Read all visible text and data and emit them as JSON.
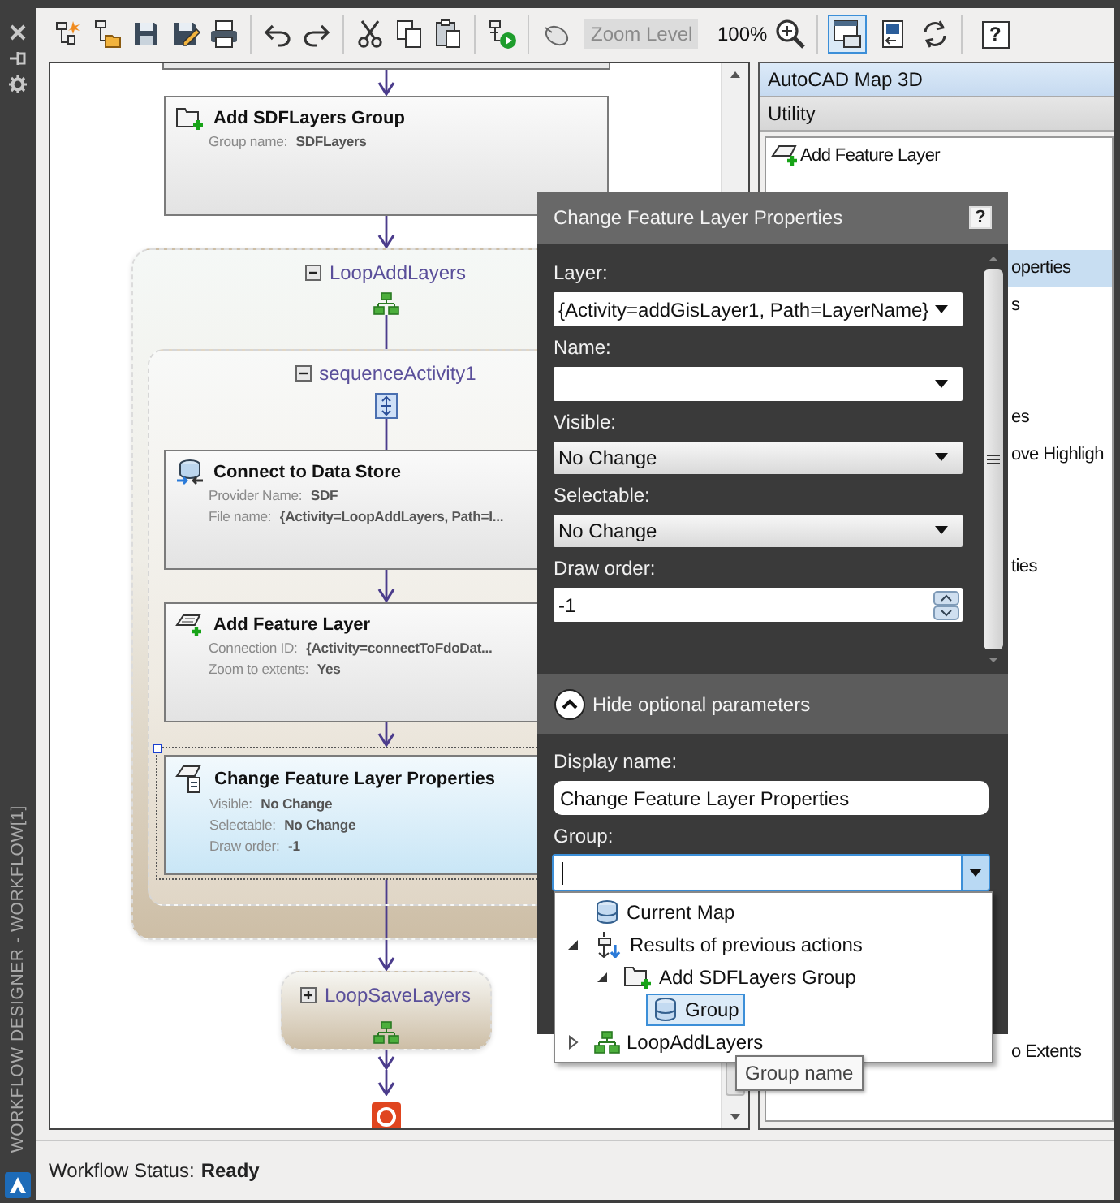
{
  "side_strip": {
    "title": "WORKFLOW DESIGNER - WORKFLOW[1]"
  },
  "toolbar": {
    "zoom_field": {
      "placeholder": "Zoom Level",
      "disabled": true
    },
    "zoom_value": "100%",
    "help_label": "?",
    "view_toggles": [
      {
        "selected": true
      },
      {
        "selected": false
      }
    ]
  },
  "workflow": {
    "items": [
      {
        "kind": "activity",
        "title": "Add SDFLayers Group",
        "selected": false,
        "fields": [
          {
            "label": "Group name:",
            "value": "SDFLayers"
          }
        ]
      },
      {
        "kind": "loop",
        "title": "LoopAddLayers",
        "expanded": true,
        "children": [
          {
            "kind": "sequence",
            "title": "sequenceActivity1",
            "expanded": true,
            "children": [
              {
                "kind": "activity",
                "title": "Connect to Data Store",
                "selected": false,
                "fields": [
                  {
                    "label": "Provider Name:",
                    "value": "SDF"
                  },
                  {
                    "label": "File name:",
                    "value": "{Activity=LoopAddLayers, Path=I..."
                  }
                ]
              },
              {
                "kind": "activity",
                "title": "Add Feature Layer",
                "selected": false,
                "fields": [
                  {
                    "label": "Connection ID:",
                    "value": "{Activity=connectToFdoDat..."
                  },
                  {
                    "label": "Zoom to extents:",
                    "value": "Yes"
                  }
                ]
              },
              {
                "kind": "activity",
                "title": "Change Feature Layer Properties",
                "selected": true,
                "fields": [
                  {
                    "label": "Visible:",
                    "value": "No Change"
                  },
                  {
                    "label": "Selectable:",
                    "value": "No Change"
                  },
                  {
                    "label": "Draw order:",
                    "value": "-1"
                  }
                ]
              }
            ]
          }
        ]
      },
      {
        "kind": "loop",
        "title": "LoopSaveLayers",
        "expanded": false
      }
    ]
  },
  "toolbox": {
    "sections": [
      {
        "title": "AutoCAD Map 3D",
        "selected": true
      },
      {
        "title": "Utility",
        "selected": false
      }
    ],
    "items": [
      {
        "text": "Add Feature Layer",
        "selected": false
      },
      {
        "text": "operties",
        "selected": true
      },
      {
        "text": "s",
        "selected": false
      },
      {
        "text": "es",
        "selected": false
      },
      {
        "text": "ove Highligh",
        "selected": false
      },
      {
        "text": "ties",
        "selected": false
      },
      {
        "text": "o Extents",
        "selected": false
      }
    ]
  },
  "properties_dialog": {
    "title": "Change Feature Layer Properties",
    "help_label": "?",
    "fields": [
      {
        "kind": "combo",
        "label": "Layer:",
        "value": "{Activity=addGisLayer1, Path=LayerName}"
      },
      {
        "kind": "combo",
        "label": "Name:"
      },
      {
        "kind": "dropdown",
        "label": "Visible:",
        "value": "No Change"
      },
      {
        "kind": "dropdown",
        "label": "Selectable:",
        "value": "No Change"
      },
      {
        "kind": "spin",
        "label": "Draw order:",
        "value": "-1"
      }
    ],
    "optional_toggle": {
      "label": "Hide optional parameters",
      "expanded": true
    },
    "optional_fields": [
      {
        "kind": "text",
        "label": "Display name:",
        "value": "Change Feature Layer Properties"
      },
      {
        "kind": "combo",
        "label": "Group:",
        "focused": true,
        "open": true
      }
    ],
    "group_dropdown": {
      "items": [
        {
          "kind": "map",
          "label": "Current Map",
          "selected": false
        },
        {
          "kind": "results",
          "label": "Results of previous actions",
          "selected": false,
          "expanded": true,
          "children": [
            {
              "kind": "activity",
              "label": "Add SDFLayers Group",
              "selected": false,
              "expanded": true,
              "children": [
                {
                  "kind": "variable",
                  "label": "Group",
                  "selected": true
                }
              ]
            }
          ]
        },
        {
          "kind": "loop",
          "label": "LoopAddLayers",
          "selected": false,
          "expanded": false
        }
      ]
    },
    "tooltip": {
      "text": "Group name"
    }
  },
  "status_bar": {
    "label": "Workflow Status:",
    "value": "Ready"
  }
}
